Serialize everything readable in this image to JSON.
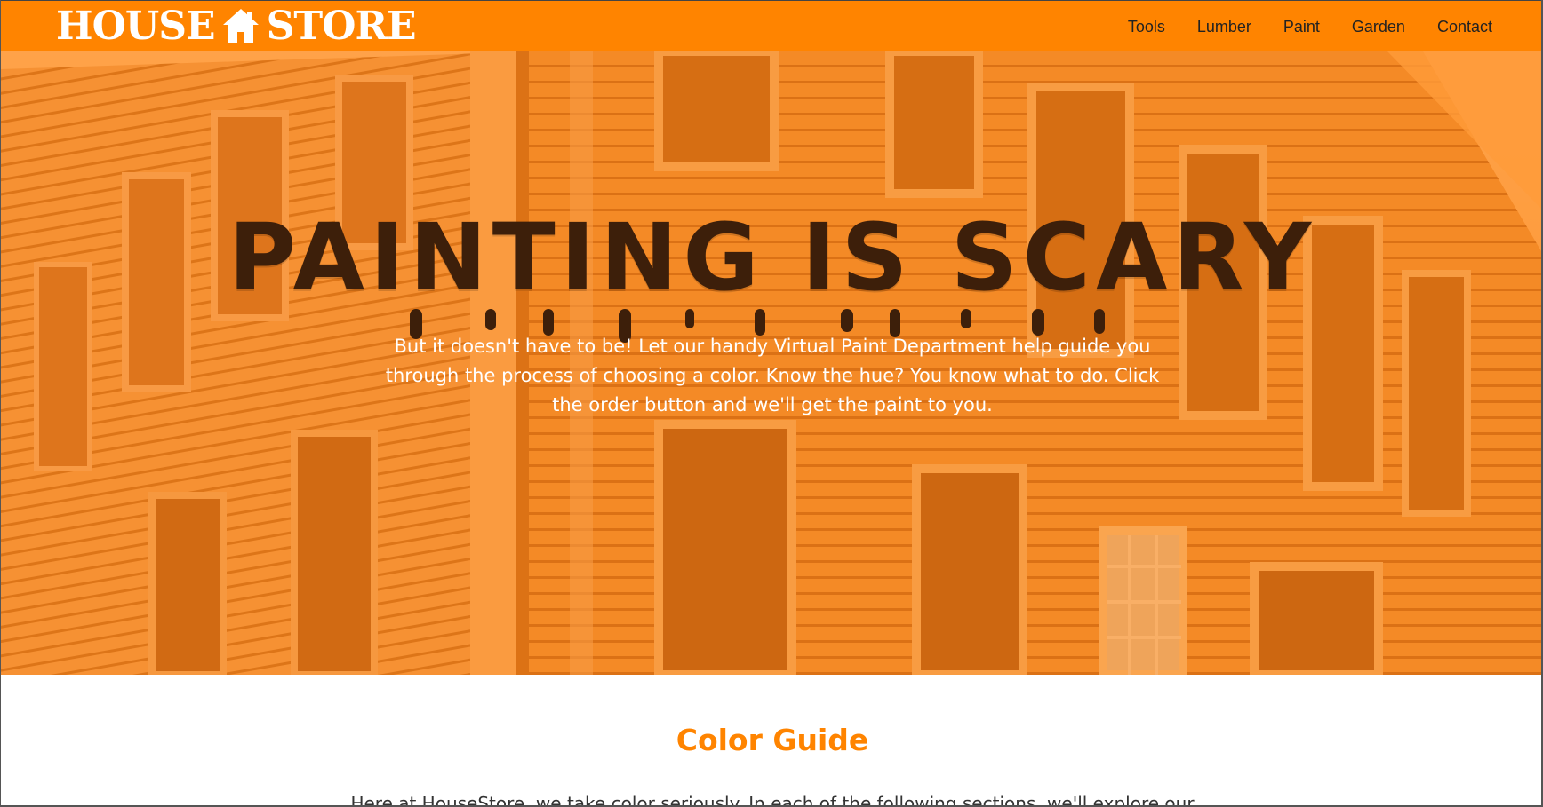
{
  "header": {
    "logo_left": "HOUSE",
    "logo_right": "STORE",
    "logo_icon": "house-icon",
    "nav": [
      {
        "label": "Tools"
      },
      {
        "label": "Lumber"
      },
      {
        "label": "Paint"
      },
      {
        "label": "Garden"
      },
      {
        "label": "Contact"
      }
    ],
    "bar_color": "#ff8400"
  },
  "hero": {
    "title": "PAINTING IS SCARY",
    "text": "But it doesn't have to be! Let our handy Virtual Paint Department help guide you through the process of choosing a color. Know the hue? You know what to do. Click the order button and we'll get the paint to you.",
    "background": "orange-tinted photo of an old wooden house",
    "title_color": "#3d1f0a",
    "tint_color": "#ff8a1e"
  },
  "guide": {
    "title": "Color Guide",
    "text": "Here at HouseStore, we take color seriously. In each of the following sections, we'll explore our",
    "title_color": "#ff8400"
  }
}
